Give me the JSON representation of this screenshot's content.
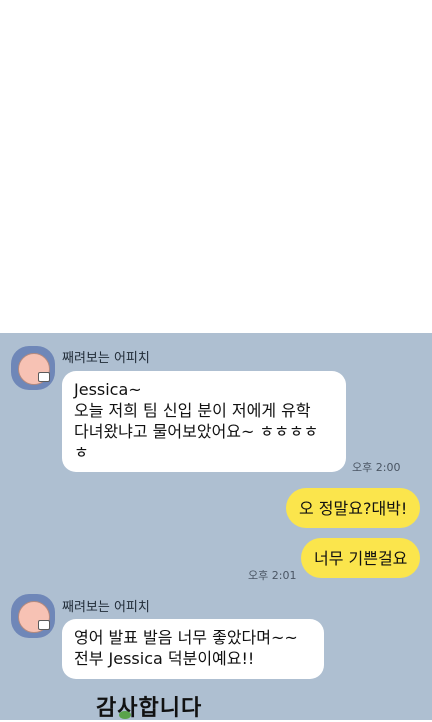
{
  "chat": {
    "messages": [
      {
        "sender": "째려보는 어피치",
        "text": "Jessica~\n오늘 저희 팀 신입 분이 저에게 유학\n다녀왔냐고 물어보았어요~ ㅎㅎㅎㅎ\nㅎ",
        "time": "오후 2:00"
      },
      {
        "text": "오 정말요?대박!"
      },
      {
        "text": "너무 기쁜걸요",
        "time": "오후 2:01"
      },
      {
        "sender": "째려보는 어피치",
        "text": "영어 발표 발음 너무 좋았다며~~\n전부 Jessica 덕분이예요!!"
      }
    ],
    "sticker_text": "감사합니다"
  }
}
